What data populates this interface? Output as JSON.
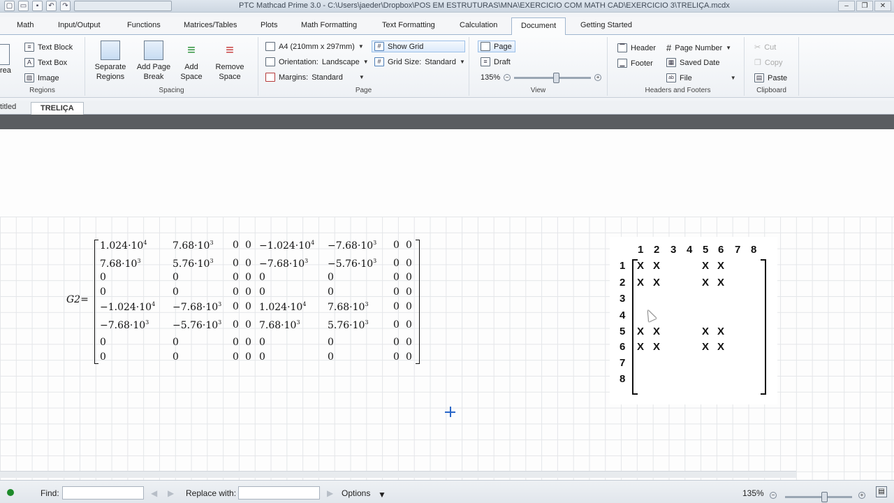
{
  "window": {
    "title": "PTC Mathcad Prime 3.0 - C:\\Users\\jaeder\\Dropbox\\POS EM ESTRUTURAS\\MNA\\EXERCICIO COM MATH CAD\\EXERCICIO 3\\TRELIÇA.mcdx",
    "minimize": "–",
    "restore": "❐",
    "close": "✕"
  },
  "menu_tabs": [
    "Math",
    "Input/Output",
    "Functions",
    "Matrices/Tables",
    "Plots",
    "Math Formatting",
    "Text Formatting",
    "Calculation",
    "Document",
    "Getting Started"
  ],
  "ribbon": {
    "regions": {
      "title": "Regions",
      "area": "rea",
      "text_block": "Text Block",
      "text_box": "Text Box",
      "image": "Image"
    },
    "spacing": {
      "title": "Spacing",
      "separate_regions": [
        "Separate",
        "Regions"
      ],
      "add_page_break": [
        "Add Page",
        "Break"
      ],
      "add_space": [
        "Add",
        "Space"
      ],
      "remove_space": [
        "Remove",
        "Space"
      ]
    },
    "page": {
      "title": "Page",
      "paper": "A4 (210mm x 297mm)",
      "orientation_label": "Orientation:",
      "orientation_value": "Landscape",
      "margins_label": "Margins:",
      "margins_value": "Standard",
      "show_grid": "Show Grid",
      "grid_size_label": "Grid Size:",
      "grid_size_value": "Standard"
    },
    "view": {
      "title": "View",
      "page": "Page",
      "draft": "Draft",
      "zoom": "135%"
    },
    "headers_footers": {
      "title": "Headers and Footers",
      "header": "Header",
      "footer": "Footer",
      "page_number": "Page Number",
      "saved_date": "Saved Date",
      "file": "File"
    },
    "clipboard": {
      "title": "Clipboard",
      "cut": "Cut",
      "copy": "Copy",
      "paste": "Paste"
    }
  },
  "doc_tabs": {
    "untitled": "titled",
    "active": "TRELIÇA"
  },
  "worksheet": {
    "matrix_name": "G2",
    "matrix_rows": [
      [
        "1.024·10^4",
        "7.68·10^3",
        "0",
        "0",
        "−1.024·10^4",
        "−7.68·10^3",
        "0",
        "0"
      ],
      [
        "7.68·10^3",
        "5.76·10^3",
        "0",
        "0",
        "−7.68·10^3",
        "−5.76·10^3",
        "0",
        "0"
      ],
      [
        "0",
        "0",
        "0",
        "0",
        "0",
        "0",
        "0",
        "0"
      ],
      [
        "0",
        "0",
        "0",
        "0",
        "0",
        "0",
        "0",
        "0"
      ],
      [
        "−1.024·10^4",
        "−7.68·10^3",
        "0",
        "0",
        "1.024·10^4",
        "7.68·10^3",
        "0",
        "0"
      ],
      [
        "−7.68·10^3",
        "−5.76·10^3",
        "0",
        "0",
        "7.68·10^3",
        "5.76·10^3",
        "0",
        "0"
      ],
      [
        "0",
        "0",
        "0",
        "0",
        "0",
        "0",
        "0",
        "0"
      ],
      [
        "0",
        "0",
        "0",
        "0",
        "0",
        "0",
        "0",
        "0"
      ]
    ],
    "image": {
      "col_headers": [
        "1",
        "2",
        "3",
        "4",
        "5",
        "6",
        "7",
        "8"
      ],
      "row_headers": [
        "1",
        "2",
        "3",
        "4",
        "5",
        "6",
        "7",
        "8"
      ],
      "mark": "X",
      "marked_rows": [
        1,
        2,
        5,
        6
      ],
      "marked_cols": [
        1,
        2,
        5,
        6
      ]
    }
  },
  "status": {
    "find_label": "Find:",
    "find_value": "",
    "replace_label": "Replace with:",
    "replace_value": "",
    "options": "Options",
    "zoom": "135%"
  }
}
